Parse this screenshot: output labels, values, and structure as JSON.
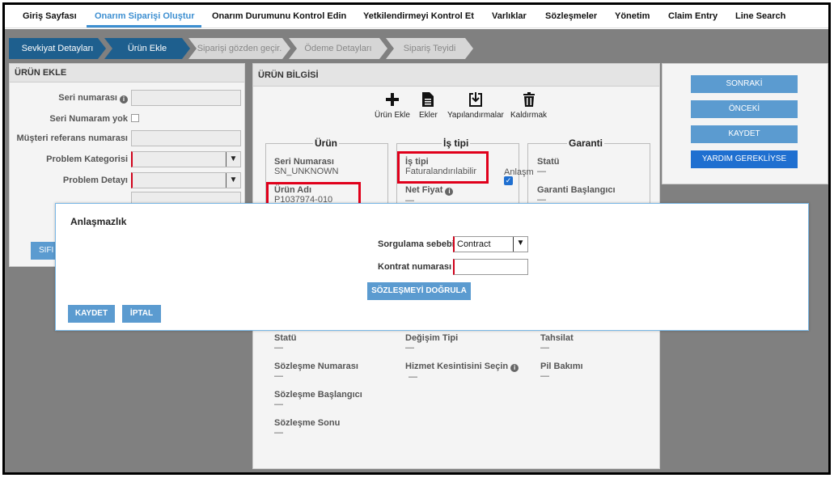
{
  "nav": {
    "items": [
      {
        "label": "Giriş Sayfası",
        "active": false
      },
      {
        "label": "Onarım Siparişi Oluştur",
        "active": true
      },
      {
        "label": "Onarım Durumunu Kontrol Edin",
        "active": false
      },
      {
        "label": "Yetkilendirmeyi Kontrol Et",
        "active": false
      },
      {
        "label": "Varlıklar",
        "active": false
      },
      {
        "label": "Sözleşmeler",
        "active": false
      },
      {
        "label": "Yönetim",
        "active": false
      },
      {
        "label": "Claim Entry",
        "active": false
      },
      {
        "label": "Line Search",
        "active": false
      }
    ],
    "accent": "#3d8fd1"
  },
  "steps": [
    {
      "label": "Sevkiyat Detayları",
      "state": "done"
    },
    {
      "label": "Ürün Ekle",
      "state": "done"
    },
    {
      "label": "Siparişi gözden geçir.",
      "state": "todo"
    },
    {
      "label": "Ödeme Detayları",
      "state": "todo"
    },
    {
      "label": "Sipariş Teyidi",
      "state": "todo"
    }
  ],
  "left_panel": {
    "title": "ÜRÜN EKLE",
    "serial_label": "Seri numarası",
    "no_serial_label": "Seri Numaram yok",
    "customer_ref_label": "Müşteri referans numarası",
    "problem_category_label": "Problem Kategorisi",
    "problem_detail_label": "Problem Detayı",
    "reset_label": "SIFI"
  },
  "product_panel": {
    "title": "ÜRÜN BİLGİSİ",
    "tools": {
      "add": "Ürün Ekle",
      "attachments": "Ekler",
      "configurations": "Yapılandırmalar",
      "remove": "Kaldırmak"
    },
    "groups": {
      "product": "Ürün",
      "job_type": "İş tipi",
      "warranty": "Garanti"
    },
    "fields": {
      "serial_number_label": "Seri Numarası",
      "serial_number_value": "SN_UNKNOWN",
      "product_name_label": "Ürün Adı",
      "product_name_value": "P1037974-010",
      "job_type_label": "İş tipi",
      "job_type_value": "Faturalandırılabilir",
      "dispute_label": "Anlaşm",
      "net_price_label": "Net Fiyat",
      "net_price_value": "—",
      "status_label": "Statü",
      "status_value": "—",
      "warranty_start_label": "Garanti Başlangıcı",
      "warranty_start_value": "—",
      "lower_status_label": "Statü",
      "lower_status_value": "—",
      "exchange_type_label": "Değişim Tipi",
      "exchange_type_value": "—",
      "collection_label": "Tahsilat",
      "collection_value": "—",
      "contract_number_label": "Sözleşme Numarası",
      "contract_number_value": "—",
      "service_interrupt_label": "Hizmet Kesintisini Seçin",
      "service_interrupt_value": "—",
      "battery_label": "Pil Bakımı",
      "battery_value": "—",
      "contract_start_label": "Sözleşme Başlangıcı",
      "contract_start_value": "—",
      "contract_end_label": "Sözleşme Sonu",
      "contract_end_value": "—"
    }
  },
  "right_panel": {
    "next": "SONRAKİ",
    "prev": "ÖNCEKİ",
    "save": "KAYDET",
    "help": "YARDIM GEREKLİYSE"
  },
  "modal": {
    "title": "Anlaşmazlık",
    "reason_label": "Sorgulama sebebi",
    "reason_value": "Contract",
    "contract_number_label": "Kontrat numarası",
    "contract_number_value": "",
    "verify_label": "SÖZLEŞMEYİ DOĞRULA",
    "save_label": "KAYDET",
    "cancel_label": "İPTAL"
  },
  "colors": {
    "button": "#5b9bd0",
    "button_primary": "#1f6fd0",
    "step_done": "#1e5f8e",
    "highlight": "#e0001b",
    "required": "#d0021b"
  }
}
